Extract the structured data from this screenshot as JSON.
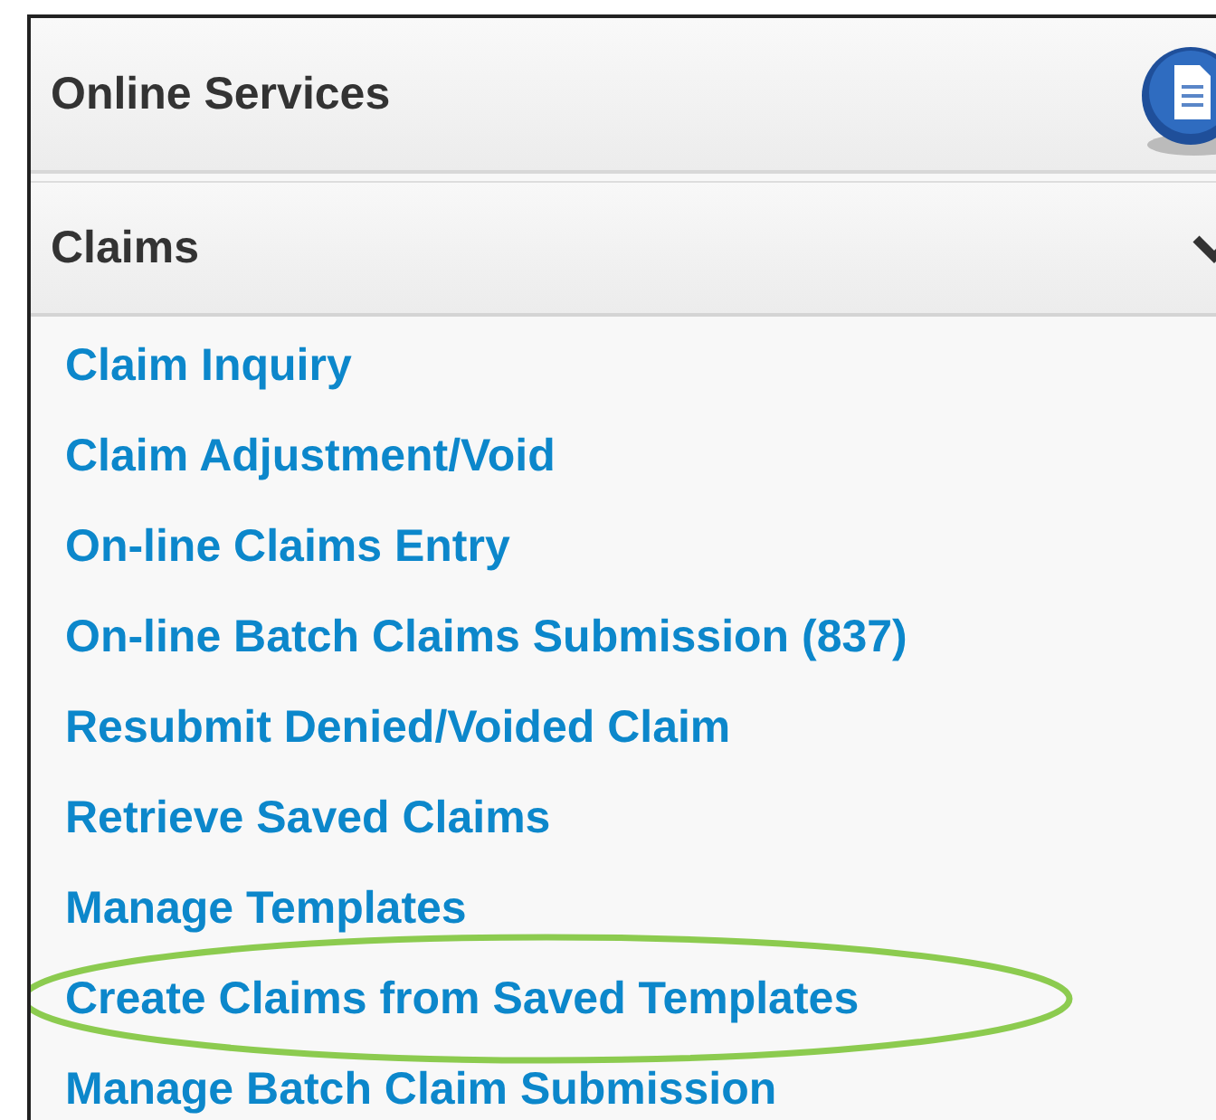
{
  "panel": {
    "title": "Online Services"
  },
  "section": {
    "title": "Claims",
    "expanded": true
  },
  "links": [
    {
      "label": "Claim Inquiry",
      "highlighted": false
    },
    {
      "label": "Claim Adjustment/Void",
      "highlighted": false
    },
    {
      "label": "On-line Claims Entry",
      "highlighted": false
    },
    {
      "label": "On-line Batch Claims Submission (837)",
      "highlighted": false
    },
    {
      "label": "Resubmit Denied/Voided Claim",
      "highlighted": false
    },
    {
      "label": "Retrieve Saved Claims",
      "highlighted": false
    },
    {
      "label": "Manage Templates",
      "highlighted": false
    },
    {
      "label": "Create Claims from Saved Templates",
      "highlighted": true
    },
    {
      "label": "Manage Batch Claim Submission",
      "highlighted": false
    }
  ]
}
